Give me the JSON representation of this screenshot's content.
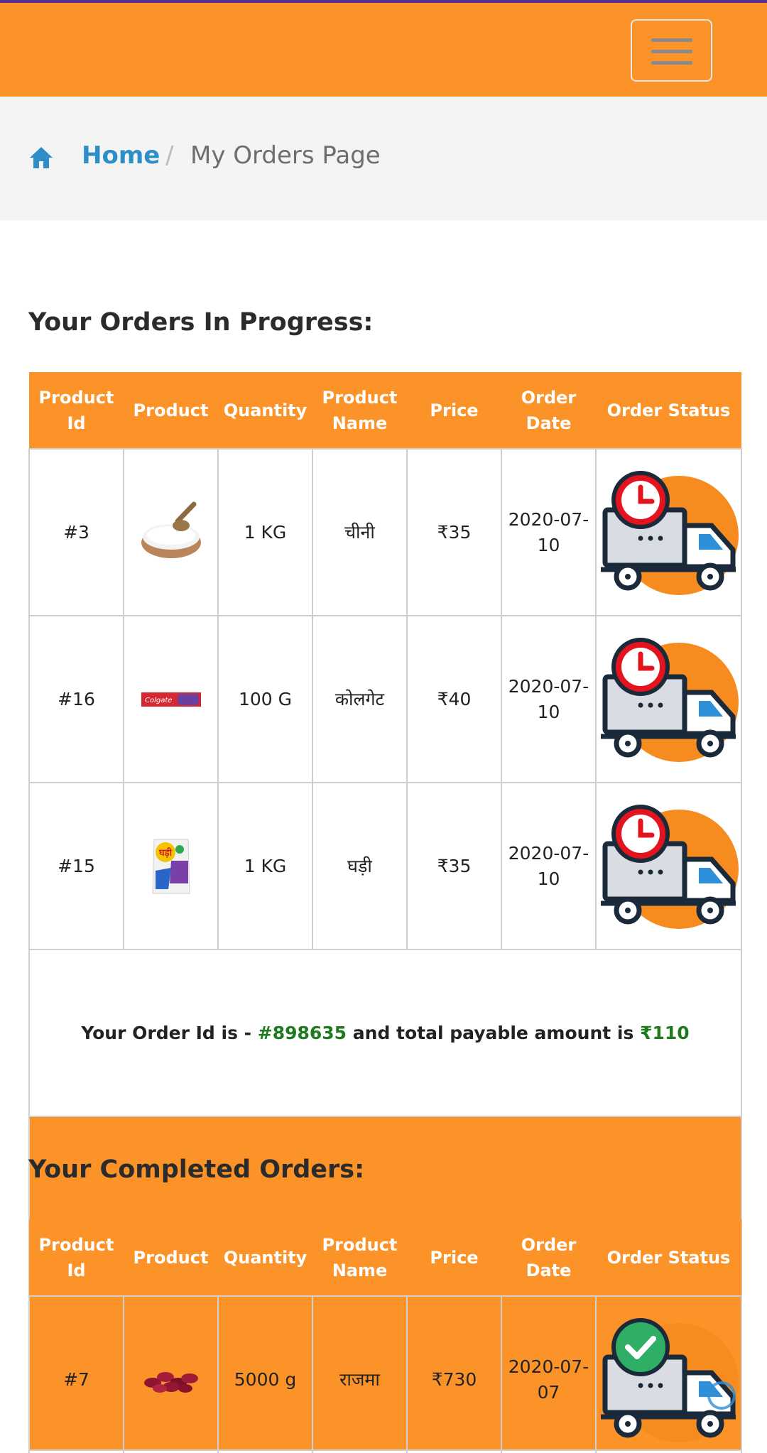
{
  "navbar": {
    "menu_icon": "hamburger-menu-icon"
  },
  "breadcrumb": {
    "home_icon": "home-icon",
    "home_label": "Home",
    "separator": "/",
    "current": "My Orders Page"
  },
  "in_progress": {
    "title": "Your Orders In Progress:",
    "headers": [
      "Product Id",
      "Product",
      "Quantity",
      "Product Name",
      "Price",
      "Order Date",
      "Order Status"
    ],
    "rows": [
      {
        "id": "#3",
        "image": "sugar-bowl",
        "quantity": "1 KG",
        "name": "चीनी",
        "price": "₹35",
        "date": "2020-07-10",
        "status_icon": "truck-clock-icon"
      },
      {
        "id": "#16",
        "image": "colgate-toothpaste",
        "quantity": "100 G",
        "name": "कोलगेट",
        "price": "₹40",
        "date": "2020-07-10",
        "status_icon": "truck-clock-icon"
      },
      {
        "id": "#15",
        "image": "ghadi-detergent",
        "quantity": "1 KG",
        "name": "घड़ी",
        "price": "₹35",
        "date": "2020-07-10",
        "status_icon": "truck-clock-icon"
      }
    ],
    "summary": {
      "prefix": "Your Order Id is - ",
      "order_id": "#898635",
      "middle": " and total payable amount is ",
      "total": "₹110"
    }
  },
  "completed": {
    "title": "Your Completed Orders:",
    "headers": [
      "Product Id",
      "Product",
      "Quantity",
      "Product Name",
      "Price",
      "Order Date",
      "Order Status"
    ],
    "rows": [
      {
        "id": "#7",
        "image": "rajma-beans",
        "quantity": "5000 g",
        "name": "राजमा",
        "price": "₹730",
        "date": "2020-07-07",
        "status_icon": "truck-check-icon"
      }
    ]
  },
  "colors": {
    "brand_orange": "#fb9329",
    "link_blue": "#2e8fc8",
    "highlight_green": "#1f7a1f"
  }
}
